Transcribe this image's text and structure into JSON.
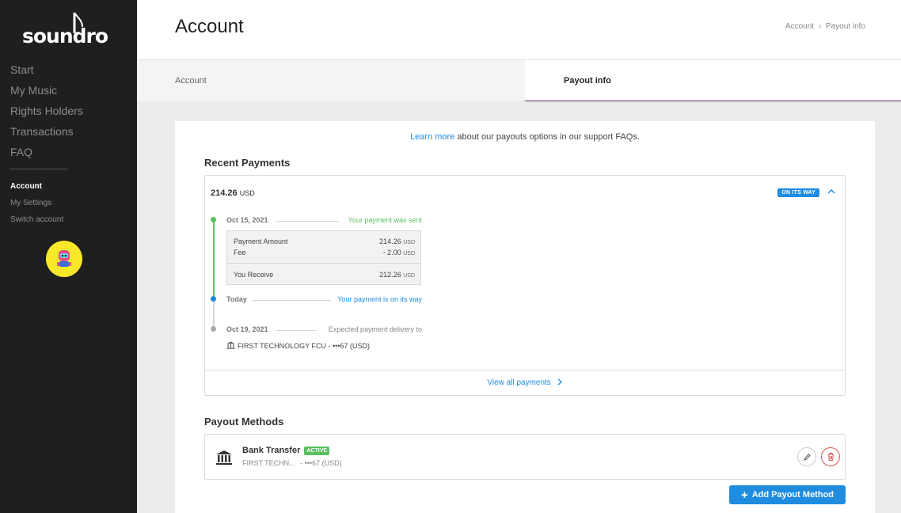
{
  "brand": {
    "logo_text": "soundrop",
    "accent": "#1f8ce0",
    "success": "#5cbf60",
    "danger": "#d9534f",
    "avatar_bg": "#f9e82a"
  },
  "sidebar": {
    "items": [
      {
        "label": "Start"
      },
      {
        "label": "My Music"
      },
      {
        "label": "Rights Holders"
      },
      {
        "label": "Transactions"
      },
      {
        "label": "FAQ"
      }
    ],
    "sub_items": [
      {
        "label": "Account",
        "active": true
      },
      {
        "label": "My Settings"
      },
      {
        "label": "Switch account"
      }
    ]
  },
  "header": {
    "title": "Account",
    "breadcrumb": [
      "Account",
      "Payout info"
    ],
    "breadcrumb_sep": "›"
  },
  "tabs": [
    {
      "label": "Account"
    },
    {
      "label": "Payout info",
      "active": true
    }
  ],
  "main": {
    "learn_more_link": "Learn more",
    "learn_more_text": " about our payouts options in our support FAQs.",
    "recent_payments_title": "Recent Payments",
    "payment": {
      "amount": "214.26",
      "currency": "USD",
      "status": "ON ITS WAY",
      "timeline": [
        {
          "date": "Oct 15, 2021",
          "message": "Your payment was sent",
          "color": "#5cbf60"
        },
        {
          "date": "Today",
          "message": "Your payment is on its way",
          "color": "#1f8ce0"
        },
        {
          "date": "Oct 19, 2021",
          "message": "Expected payment delivery to",
          "color": "#999999"
        }
      ],
      "breakdown": {
        "payment_amount_label": "Payment Amount",
        "payment_amount_value": "214.26",
        "fee_label": "Fee",
        "fee_value": "- 2.00",
        "receive_label": "You Receive",
        "receive_value": "212.26",
        "currency": "USD"
      },
      "bank": "FIRST TECHNOLOGY FCU - •••67 (USD)"
    },
    "view_all_label": "View all payments",
    "payout_methods_title": "Payout Methods",
    "method": {
      "name": "Bank Transfer",
      "badge": "ACTIVE",
      "detail_name": "FIRST TECHN...",
      "detail_account": "- •••67 (USD)"
    },
    "add_button": "Add Payout Method"
  }
}
